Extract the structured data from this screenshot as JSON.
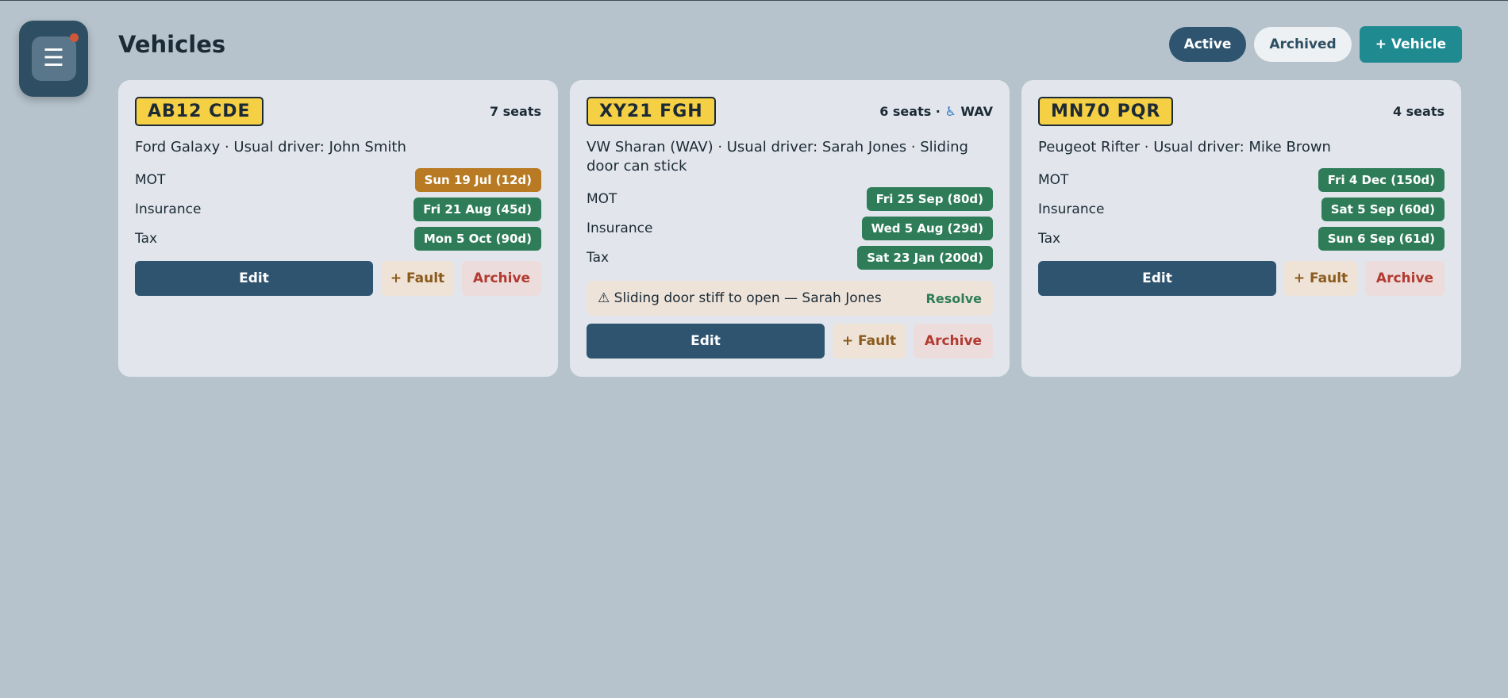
{
  "header": {
    "menu_icon": "☰",
    "title": "Vehicles",
    "filters": {
      "active_label": "Active",
      "archived_label": "Archived"
    },
    "add_label": "+ Vehicle"
  },
  "colors": {
    "ok": "#2f7d58",
    "warning": "#b87a22",
    "primary": "#2e5470",
    "accent": "#1f8a90",
    "plate": "#f5cf44"
  },
  "vehicles": [
    {
      "plate": "AB12 CDE",
      "seats": "7 seats",
      "description": "Ford Galaxy · Usual driver: John Smith",
      "mot_label": "MOT",
      "mot": "Sun 19 Jul (12d)",
      "insurance_label": "Insurance",
      "insurance": "Fri 21 Aug (45d)",
      "tax_label": "Tax",
      "tax": "Mon 5 Oct (90d)",
      "edit_label": "Edit",
      "fault_label": "+ Fault",
      "archive_label": "Archive"
    },
    {
      "plate": "XY21 FGH",
      "seats": "6 seats ·",
      "wav_icon": "♿",
      "wav_label": "WAV",
      "description": "VW Sharan (WAV) · Usual driver: Sarah Jones · Sliding door can stick",
      "mot_label": "MOT",
      "mot": "Fri 25 Sep (80d)",
      "insurance_label": "Insurance",
      "insurance": "Wed 5 Aug (29d)",
      "tax_label": "Tax",
      "tax": "Sat 23 Jan (200d)",
      "fault": {
        "warning_icon": "⚠",
        "text": "Sliding door stiff to open — Sarah Jones",
        "resolve_label": "Resolve"
      },
      "edit_label": "Edit",
      "fault_label": "+ Fault",
      "archive_label": "Archive"
    },
    {
      "plate": "MN70 PQR",
      "seats": "4 seats",
      "description": "Peugeot Rifter · Usual driver: Mike Brown",
      "mot_label": "MOT",
      "mot": "Fri 4 Dec (150d)",
      "insurance_label": "Insurance",
      "insurance": "Sat 5 Sep (60d)",
      "tax_label": "Tax",
      "tax": "Sun 6 Sep (61d)",
      "edit_label": "Edit",
      "fault_label": "+ Fault",
      "archive_label": "Archive"
    }
  ]
}
